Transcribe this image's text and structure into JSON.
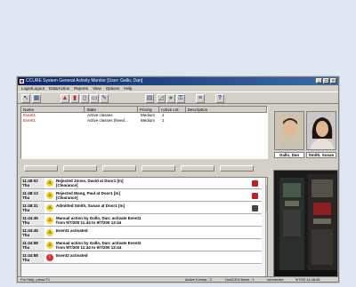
{
  "window": {
    "title": "CCURE System General Activity Monitor [User: Gallo, Dan]",
    "controls": [
      "_",
      "□",
      "×"
    ]
  },
  "menu": [
    "Login/Logout",
    "Data/Action",
    "Reports",
    "View",
    "Options",
    "Help"
  ],
  "toolbar": {
    "icons": [
      "pointer-icon",
      "grid-icon",
      "alarm-icon",
      "chart-icon",
      "filter-icon",
      "card-icon",
      "edit-icon",
      "window-icon",
      "graph-icon",
      "camera-icon",
      "key-icon",
      "list-icon",
      "help-icon"
    ],
    "help_label": "?"
  },
  "activity_list": {
    "headers": [
      "Name",
      "State",
      "Priority",
      "Active cnt.",
      "Description"
    ],
    "rows": [
      {
        "name": "Event1",
        "state": "Active classes",
        "priority": "Medium",
        "count": "1",
        "description": ""
      },
      {
        "name": "Event1",
        "state": "Active classes (Need...",
        "priority": "Medium",
        "count": "1",
        "description": ""
      }
    ]
  },
  "photos": [
    {
      "caption": "Gallo, Dan"
    },
    {
      "caption": "Smith, Susan"
    }
  ],
  "events": [
    {
      "time": "11:48:02",
      "day": "Thu",
      "text": "Rejected Jones, David at Door1 [In]",
      "text2": "[Clearance]",
      "color": "#f4d23a",
      "lock": true
    },
    {
      "time": "11:48:13",
      "day": "Thu",
      "text": "Rejected Wang, Paul at Door1 [In]",
      "text2": "[Clearance]",
      "color": "#f4d23a",
      "lock": true
    },
    {
      "time": "11:48:31",
      "day": "Thu",
      "text": "Admitted Smith, Susan at Door1 [In]",
      "text2": "",
      "color": "#f4d23a",
      "lock": true
    },
    {
      "time": "11:44:45",
      "day": "Thu",
      "text": "Manual action by Gallo, Dan: activate Event1",
      "text2": "from 9/7/200 11:44 to 9/7/200 12:44",
      "color": "#f4d23a",
      "lock": false
    },
    {
      "time": "11:44:45",
      "day": "Thu",
      "text": "Event1 activated",
      "text2": "",
      "color": "#f4d23a",
      "lock": false
    },
    {
      "time": "11:44:58",
      "day": "Thu",
      "text": "Manual action by Gallo, Dan: activate Event2",
      "text2": "from 9/7/200 11:44 to 9/7/200 12:44",
      "color": "#f4d23a",
      "lock": false
    },
    {
      "time": "11:44:58",
      "day": "Thu",
      "text": "Event2 activated",
      "text2": "",
      "color": "#d83030",
      "lock": false
    }
  ],
  "status": {
    "left": "For Help, press F1",
    "active_events": "Active Events : 2",
    "unack": "UnACK'd Items : 1",
    "connected": "connected",
    "datetime": "9/7/00 11:48:48"
  }
}
